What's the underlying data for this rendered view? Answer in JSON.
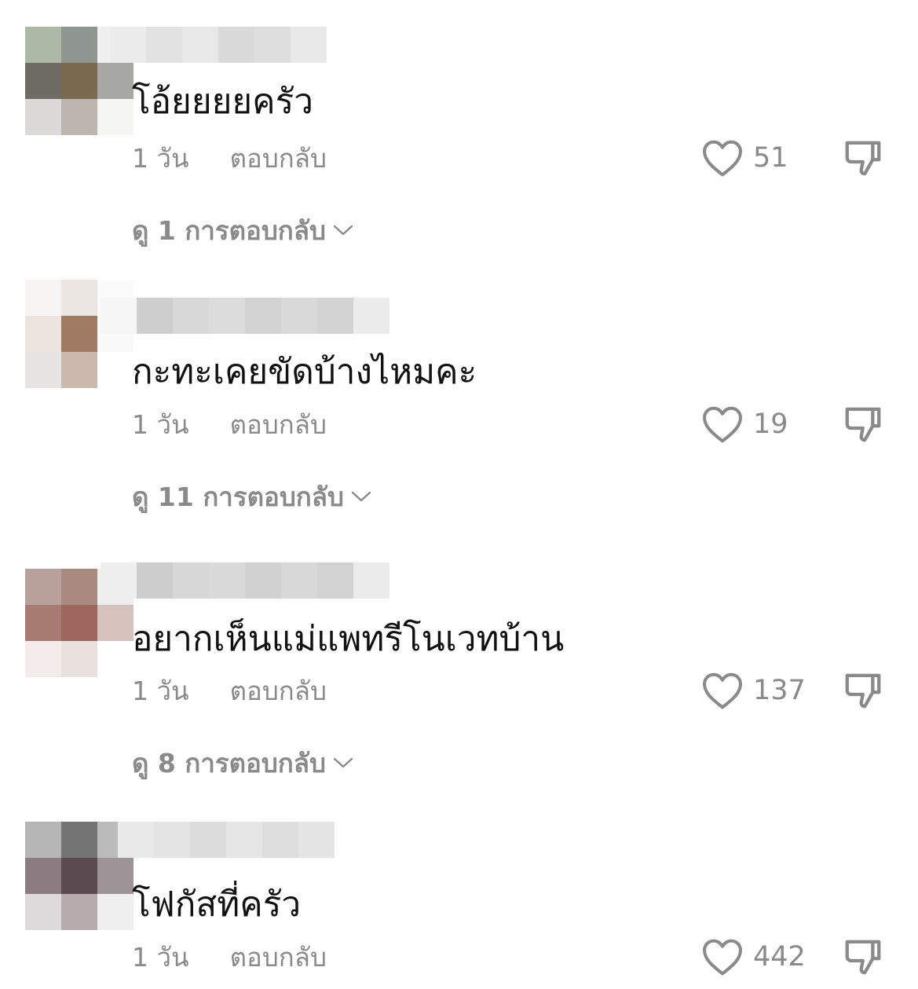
{
  "comments": [
    {
      "text": "โอ้ยยยยครัว",
      "time": "1 วัน",
      "reply_label": "ตอบกลับ",
      "likes": "51",
      "view_replies": "ดู 1 การตอบกลับ"
    },
    {
      "text": "กะทะเคยขัดบ้างไหมคะ",
      "time": "1 วัน",
      "reply_label": "ตอบกลับ",
      "likes": "19",
      "view_replies": "ดู 11 การตอบกลับ"
    },
    {
      "text": "อยากเห็นแม่แพทรีโนเวทบ้าน",
      "time": "1 วัน",
      "reply_label": "ตอบกลับ",
      "likes": "137",
      "view_replies": "ดู 8 การตอบกลับ"
    },
    {
      "text": "โฟกัสที่ครัว",
      "time": "1 วัน",
      "reply_label": "ตอบกลับ",
      "likes": "442"
    }
  ],
  "icons": {
    "like": "heart-outline-icon",
    "dislike": "thumbs-down-outline-icon",
    "expand": "chevron-down-icon"
  },
  "colors": {
    "text_primary": "#111111",
    "text_secondary": "#8a8a8a",
    "background": "#ffffff"
  }
}
